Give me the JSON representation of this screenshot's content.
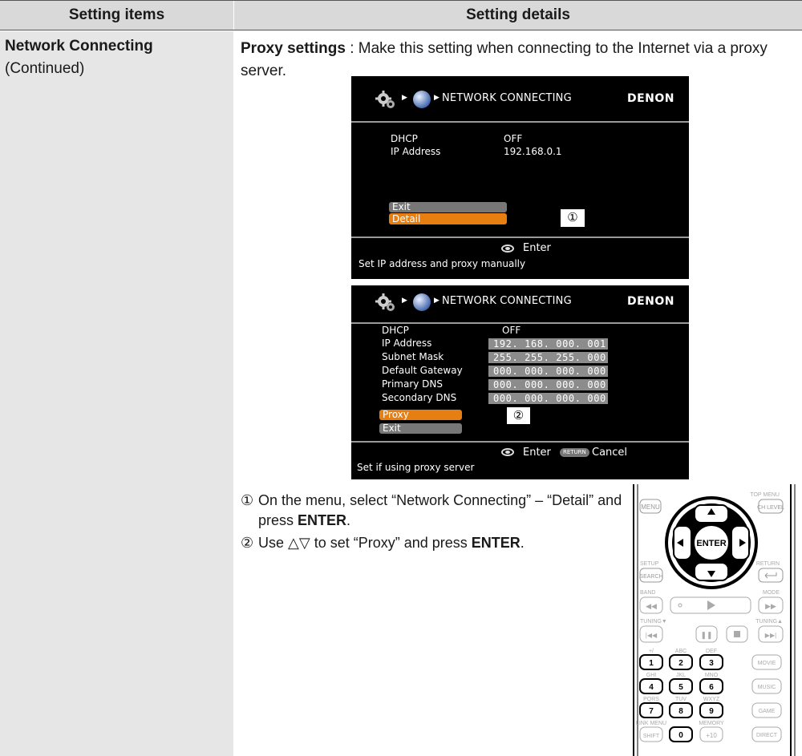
{
  "header": {
    "col1": "Setting items",
    "col2": "Setting details"
  },
  "left": {
    "title": "Network Connecting",
    "subtitle": "(Continued)"
  },
  "intro": {
    "bold": "Proxy settings",
    "text": " : Make this setting when connecting to the Internet via a proxy server."
  },
  "screen1": {
    "title": "NETWORK CONNECTING",
    "brand": "DENON",
    "dhcp_label": "DHCP",
    "dhcp_value": "OFF",
    "ip_label": "IP Address",
    "ip_value": "192.168.0.1",
    "exit": "Exit",
    "detail": "Detail",
    "enter": "Enter",
    "help": "Set IP address and proxy manually"
  },
  "screen2": {
    "title": "NETWORK CONNECTING",
    "brand": "DENON",
    "dhcp_label": "DHCP",
    "dhcp_value": "OFF",
    "rows": [
      {
        "label": "IP Address",
        "value": "192. 168. 000. 001"
      },
      {
        "label": "Subnet Mask",
        "value": "255. 255. 255. 000"
      },
      {
        "label": "Default Gateway",
        "value": "000. 000. 000. 000"
      },
      {
        "label": "Primary DNS",
        "value": "000. 000. 000. 000"
      },
      {
        "label": "Secondary DNS",
        "value": "000. 000. 000. 000"
      }
    ],
    "proxy": "Proxy",
    "exit": "Exit",
    "enter": "Enter",
    "return_icon": "RETURN",
    "cancel": "Cancel",
    "help": "Set if using proxy server"
  },
  "callouts": {
    "one": "①",
    "two": "②"
  },
  "steps": {
    "s1_num": "①",
    "s1_text": "On the menu, select “Network Connecting” – “Detail” and press ",
    "s1_bold": "ENTER",
    "s1_end": ".",
    "s2_num": "②",
    "s2_text": "Use ΔΓ to set “Proxy” and press ",
    "s2_sym": "△▽",
    "s2_pre": "Use ",
    "s2_post": " to set “Proxy” and press ",
    "s2_bold": "ENTER",
    "s2_end": "."
  },
  "remote": {
    "top_menu": "TOP MENU",
    "menu": "MENU",
    "ch_level": "CH LEVEL",
    "enter": "ENTER",
    "setup": "SETUP",
    "return": "RETURN",
    "search": "SEARCH",
    "band": "BAND",
    "mode": "MODE",
    "tuning_down": "TUNING▼",
    "tuning_up": "TUNING▲",
    "k1": "1",
    "k2": "2",
    "k3": "3",
    "k4": "4",
    "k5": "5",
    "k6": "6",
    "k7": "7",
    "k8": "8",
    "k9": "9",
    "k0": "0",
    "k10": "+10",
    "l1": "+/",
    "l2": "ABC",
    "l3": "DEF",
    "l4": "GHI",
    "l5": "JKL",
    "l6": "MNO",
    "l7": "PQRS",
    "l8": "TUV",
    "l9": "WXYZ",
    "link_menu": "LINK MENU",
    "memory": "MEMORY",
    "movie": "MOVIE",
    "music": "MUSIC",
    "game": "GAME",
    "shift": "SHIFT",
    "direct": "DIRECT"
  }
}
